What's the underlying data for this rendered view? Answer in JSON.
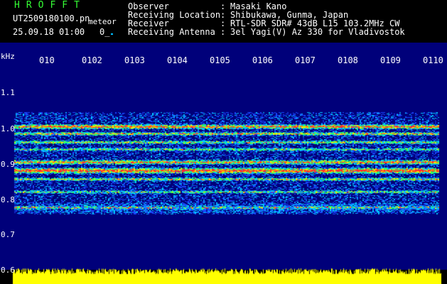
{
  "header": {
    "app_title": "HROFFT",
    "filename": "UT2509180100.pn",
    "meteor_label": "meteor",
    "timestamp": "25.09.18 01:00",
    "frame_label": "0_"
  },
  "info": [
    {
      "key": "Observer",
      "value": "Masaki Kano"
    },
    {
      "key": "Receiving Location",
      "value": "Shibukawa, Gunma, Japan"
    },
    {
      "key": "Receiver",
      "value": "RTL-SDR SDR# 43dB L15 103.2MHz CW"
    },
    {
      "key": "Receiving Antenna",
      "value": "3el Yagi(V) Az 330 for Vladivostok"
    }
  ],
  "axes": {
    "y_unit": "kHz",
    "y_ticks": [
      "1.1",
      "1.0",
      "0.9",
      "0.8",
      "0.7",
      "0.6"
    ],
    "x_ticks": [
      "010",
      "0102",
      "0103",
      "0104",
      "0105",
      "0106",
      "0107",
      "0108",
      "0109",
      "0110"
    ]
  },
  "colors": {
    "background": "#000000",
    "title": "#35ff35",
    "plot_bg": "#00007a",
    "bottom_strip": "#ffff00"
  }
}
